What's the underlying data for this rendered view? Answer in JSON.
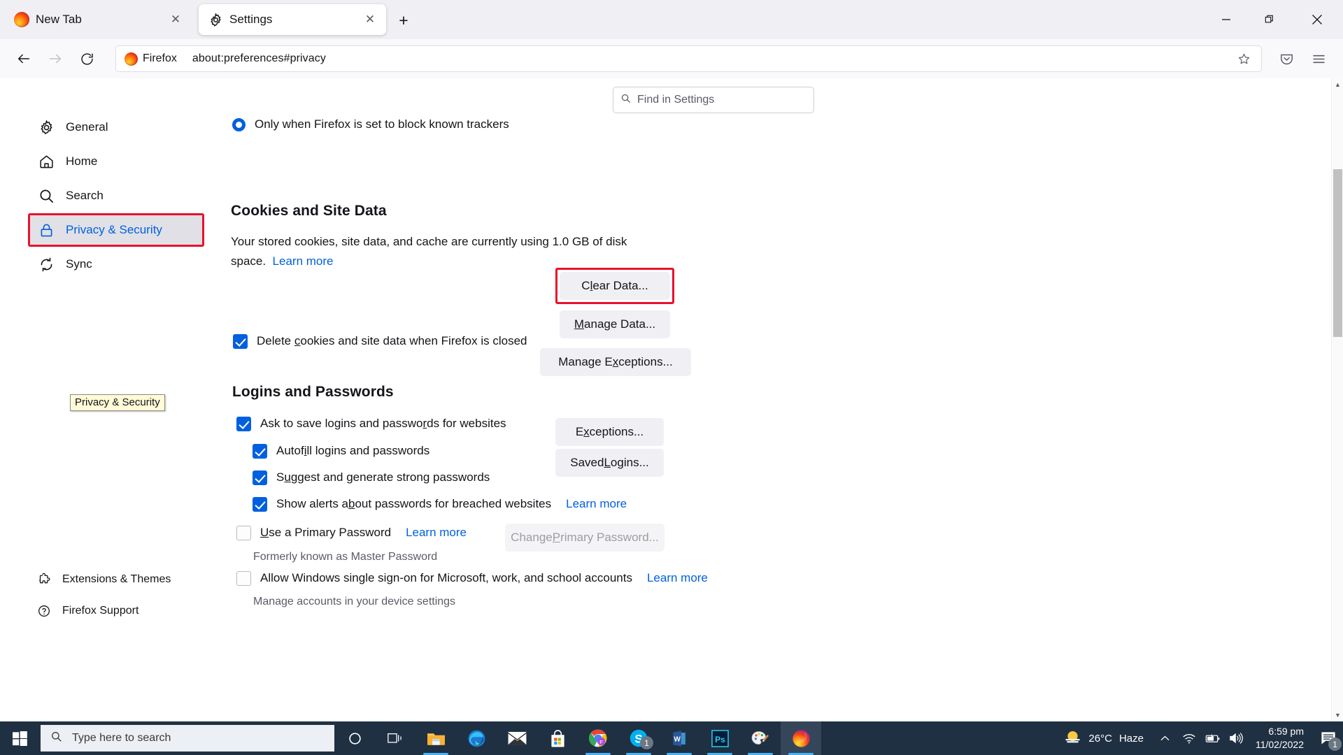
{
  "browser": {
    "tabs": [
      {
        "title": "New Tab",
        "icon": "firefox-logo",
        "active": false
      },
      {
        "title": "Settings",
        "icon": "gear-icon",
        "active": true
      }
    ],
    "new_tab_label": "+",
    "window_controls": {
      "minimize": "—",
      "maximize": "❐",
      "close": "✕"
    },
    "nav": {
      "back": "←",
      "forward": "→",
      "reload": "⟳"
    },
    "urlbar": {
      "identity_chip": "Firefox",
      "url": "about:preferences#privacy",
      "bookmark_icon": "star-icon"
    },
    "toolbar_icons": [
      "pocket-icon",
      "hamburger-menu-icon"
    ]
  },
  "search": {
    "placeholder": "Find in Settings",
    "icon": "search-icon"
  },
  "sidebar": {
    "items": [
      {
        "label": "General",
        "icon": "gear-icon",
        "selected": false
      },
      {
        "label": "Home",
        "icon": "home-icon",
        "selected": false
      },
      {
        "label": "Search",
        "icon": "search-icon",
        "selected": false
      },
      {
        "label": "Privacy & Security",
        "icon": "lock-icon",
        "selected": true
      },
      {
        "label": "Sync",
        "icon": "sync-icon",
        "selected": false
      }
    ],
    "bottom_items": [
      {
        "label": "Extensions & Themes",
        "icon": "extensions-icon"
      },
      {
        "label": "Firefox Support",
        "icon": "help-icon"
      }
    ]
  },
  "tooltip": {
    "text": "Privacy & Security"
  },
  "main": {
    "tracking_option": {
      "label": "Only when Firefox is set to block known trackers",
      "selected": true
    },
    "cookies": {
      "heading": "Cookies and Site Data",
      "description_part1": "Your stored cookies, site data, and cache are currently using ",
      "storage_size": "1.0 GB",
      "description_part2": " of disk space.",
      "learn_more": "Learn more",
      "delete_on_close": {
        "label_before": "Delete ",
        "label_key": "c",
        "label_after": "ookies and site data when Firefox is closed",
        "checked": true
      },
      "buttons": [
        {
          "label_before": "C",
          "label_key": "l",
          "label_after": "ear Data...",
          "highlighted": true
        },
        {
          "label_before": "",
          "label_key": "M",
          "label_after": "anage Data...",
          "highlighted": false
        },
        {
          "label_before": "Manage E",
          "label_key": "x",
          "label_after": "ceptions...",
          "highlighted": false
        }
      ]
    },
    "logins": {
      "heading": "Logins and Passwords",
      "checkboxes": [
        {
          "before": "Ask to save logins and passwo",
          "key": "r",
          "after": "ds for websites",
          "checked": true,
          "indent": 0
        },
        {
          "before": "Autof",
          "key": "i",
          "after": "ll logins and passwords",
          "checked": true,
          "indent": 1
        },
        {
          "before": "S",
          "key": "u",
          "after": "ggest and generate strong passwords",
          "checked": true,
          "indent": 1
        },
        {
          "before": "Show alerts a",
          "key": "b",
          "after": "out passwords for breached websites",
          "checked": true,
          "indent": 1,
          "learn_more": "Learn more"
        },
        {
          "before": "",
          "key": "U",
          "after": "se a Primary Password",
          "checked": false,
          "indent": 0,
          "learn_more": "Learn more"
        },
        {
          "before": "Allow Windows single sign-on for Microsoft, work, and school accounts",
          "key": "",
          "after": "",
          "checked": false,
          "indent": 0,
          "learn_more": "Learn more"
        }
      ],
      "note_primary": "Formerly known as Master Password",
      "note_sso": "Manage accounts in your device settings",
      "buttons": [
        {
          "before": "E",
          "key": "x",
          "after": "ceptions...",
          "disabled": false
        },
        {
          "before": "Saved ",
          "key": "L",
          "after": "ogins...",
          "disabled": false
        },
        {
          "before": "Change ",
          "key": "P",
          "after": "rimary Password...",
          "disabled": true
        }
      ]
    }
  },
  "taskbar": {
    "start_icon": "windows-start-icon",
    "search_placeholder": "Type here to search",
    "search_icon": "search-icon",
    "apps": [
      {
        "name": "cortana-icon",
        "active": false,
        "badge": ""
      },
      {
        "name": "task-view-icon",
        "active": false,
        "badge": ""
      },
      {
        "name": "file-explorer-icon",
        "active": false,
        "badge": "",
        "running": true
      },
      {
        "name": "microsoft-edge-icon",
        "active": false,
        "badge": ""
      },
      {
        "name": "mail-icon",
        "active": false,
        "badge": ""
      },
      {
        "name": "microsoft-store-icon",
        "active": false,
        "badge": ""
      },
      {
        "name": "google-chrome-icon",
        "active": false,
        "badge": "",
        "running": true
      },
      {
        "name": "skype-icon",
        "active": false,
        "badge": "1",
        "running": true
      },
      {
        "name": "microsoft-word-icon",
        "active": false,
        "badge": "",
        "running": true
      },
      {
        "name": "photoshop-icon",
        "active": false,
        "badge": "",
        "running": true
      },
      {
        "name": "paint-3d-icon",
        "active": false,
        "badge": "",
        "running": true
      },
      {
        "name": "firefox-icon",
        "active": true,
        "badge": "",
        "running": true
      }
    ],
    "tray": {
      "weather_icon": "haze-sun-icon",
      "temperature": "26°C",
      "condition": "Haze",
      "chevron": "show-hidden-icons",
      "wifi_icon": "wifi-icon",
      "battery_icon": "battery-charging-icon",
      "volume_icon": "volume-icon",
      "time": "6:59 pm",
      "date": "11/02/2022",
      "notification_icon": "action-center-icon",
      "notification_count": "1"
    }
  },
  "colors": {
    "accent": "#0060df",
    "highlight": "#e8112d",
    "chrome_bg": "#f0f0f4",
    "taskbar_bg": "#1f3043"
  }
}
